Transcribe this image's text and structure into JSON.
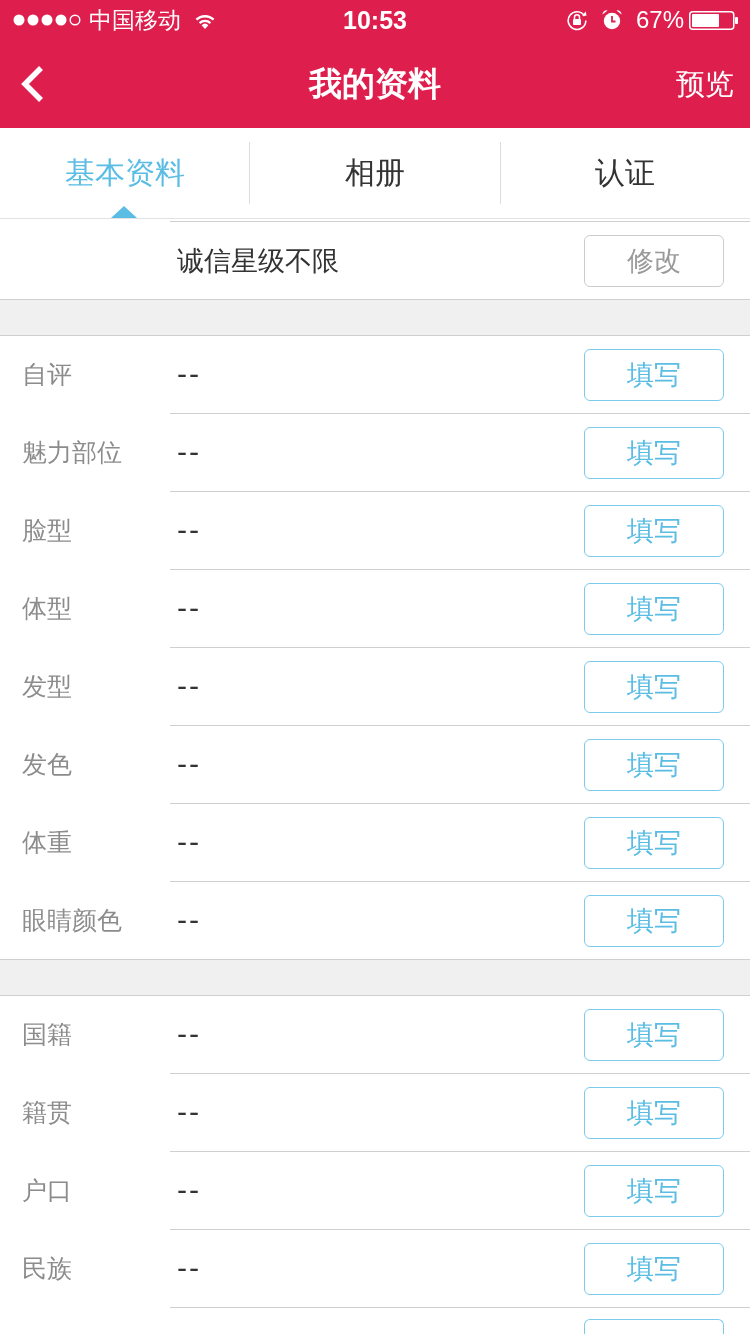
{
  "status_bar": {
    "carrier": "中国移动",
    "time": "10:53",
    "battery_percent": "67%"
  },
  "nav": {
    "title": "我的资料",
    "action": "预览"
  },
  "tabs": [
    {
      "label": "基本资料",
      "selected": true
    },
    {
      "label": "相册",
      "selected": false
    },
    {
      "label": "认证",
      "selected": false
    }
  ],
  "sections": [
    {
      "rows": [
        {
          "kind": "summary",
          "value": "诚信星级不限",
          "button": "修改"
        }
      ],
      "more_below": false
    },
    {
      "rows": [
        {
          "kind": "field",
          "label": "自评",
          "value": "--",
          "button": "填写"
        },
        {
          "kind": "field",
          "label": "魅力部位",
          "value": "--",
          "button": "填写"
        },
        {
          "kind": "field",
          "label": "脸型",
          "value": "--",
          "button": "填写"
        },
        {
          "kind": "field",
          "label": "体型",
          "value": "--",
          "button": "填写"
        },
        {
          "kind": "field",
          "label": "发型",
          "value": "--",
          "button": "填写"
        },
        {
          "kind": "field",
          "label": "发色",
          "value": "--",
          "button": "填写"
        },
        {
          "kind": "field",
          "label": "体重",
          "value": "--",
          "button": "填写"
        },
        {
          "kind": "field",
          "label": "眼睛颜色",
          "value": "--",
          "button": "填写"
        }
      ],
      "more_below": false
    },
    {
      "rows": [
        {
          "kind": "field",
          "label": "国籍",
          "value": "--",
          "button": "填写"
        },
        {
          "kind": "field",
          "label": "籍贯",
          "value": "--",
          "button": "填写"
        },
        {
          "kind": "field",
          "label": "户口",
          "value": "--",
          "button": "填写"
        },
        {
          "kind": "field",
          "label": "民族",
          "value": "--",
          "button": "填写"
        }
      ],
      "more_below": true
    }
  ]
}
